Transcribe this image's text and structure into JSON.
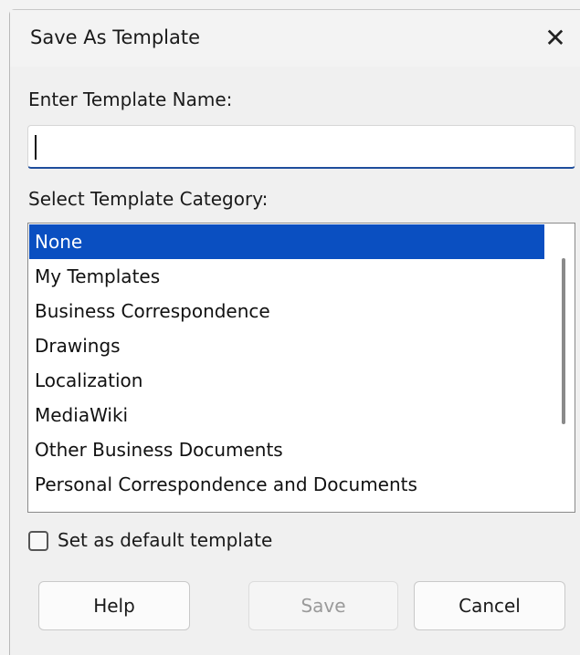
{
  "dialog": {
    "title": "Save As Template",
    "close_glyph": "✕"
  },
  "name_section": {
    "label": "Enter Template Name:",
    "value": ""
  },
  "category_section": {
    "label": "Select Template Category:",
    "items": [
      {
        "label": "None",
        "selected": true
      },
      {
        "label": "My Templates",
        "selected": false
      },
      {
        "label": "Business Correspondence",
        "selected": false
      },
      {
        "label": "Drawings",
        "selected": false
      },
      {
        "label": "Localization",
        "selected": false
      },
      {
        "label": "MediaWiki",
        "selected": false
      },
      {
        "label": "Other Business Documents",
        "selected": false
      },
      {
        "label": "Personal Correspondence and Documents",
        "selected": false
      }
    ]
  },
  "default_checkbox": {
    "label": "Set as default template",
    "checked": false
  },
  "buttons": {
    "help": "Help",
    "save": "Save",
    "cancel": "Cancel"
  },
  "colors": {
    "selection": "#0a4fc1",
    "input_underline": "#1f4e9c"
  }
}
